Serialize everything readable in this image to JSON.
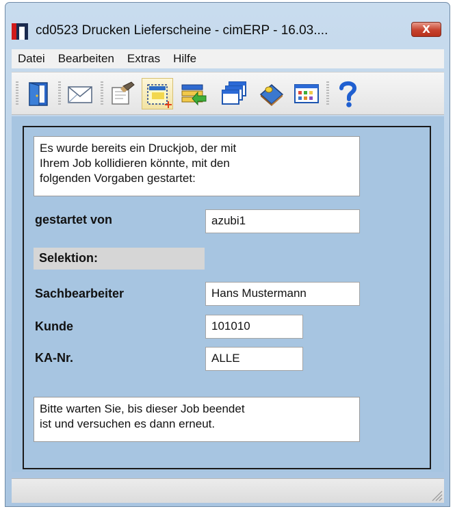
{
  "window": {
    "title": "cd0523 Drucken Lieferscheine - cimERP - 16.03....",
    "close_label": "X",
    "accent_color": "#c6422e"
  },
  "menu": {
    "items": [
      {
        "label": "Datei"
      },
      {
        "label": "Bearbeiten"
      },
      {
        "label": "Extras"
      },
      {
        "label": "Hilfe"
      }
    ]
  },
  "toolbar": {
    "buttons": [
      {
        "icon": "exit-door-icon"
      },
      {
        "icon": "mail-envelope-icon"
      },
      {
        "icon": "edit-document-icon"
      },
      {
        "icon": "new-selection-icon",
        "active": true
      },
      {
        "icon": "transfer-list-icon"
      },
      {
        "icon": "windows-stack-icon"
      },
      {
        "icon": "book-icon"
      },
      {
        "icon": "grid-view-icon"
      },
      {
        "icon": "help-icon"
      }
    ]
  },
  "dialog": {
    "message_top": "Es wurde bereits ein Druckjob, der mit\nIhrem Job kollidieren könnte, mit den\nfolgenden Vorgaben gestartet:",
    "started_by_label": "gestartet von",
    "started_by_value": "azubi1",
    "selection_label": "Selektion:",
    "clerk_label": "Sachbearbeiter",
    "clerk_value": "Hans Mustermann",
    "customer_label": "Kunde",
    "customer_value": "101010",
    "order_label": "KA-Nr.",
    "order_value": "ALLE",
    "message_bottom": "Bitte warten Sie, bis dieser Job beendet\nist und versuchen es dann erneut."
  }
}
